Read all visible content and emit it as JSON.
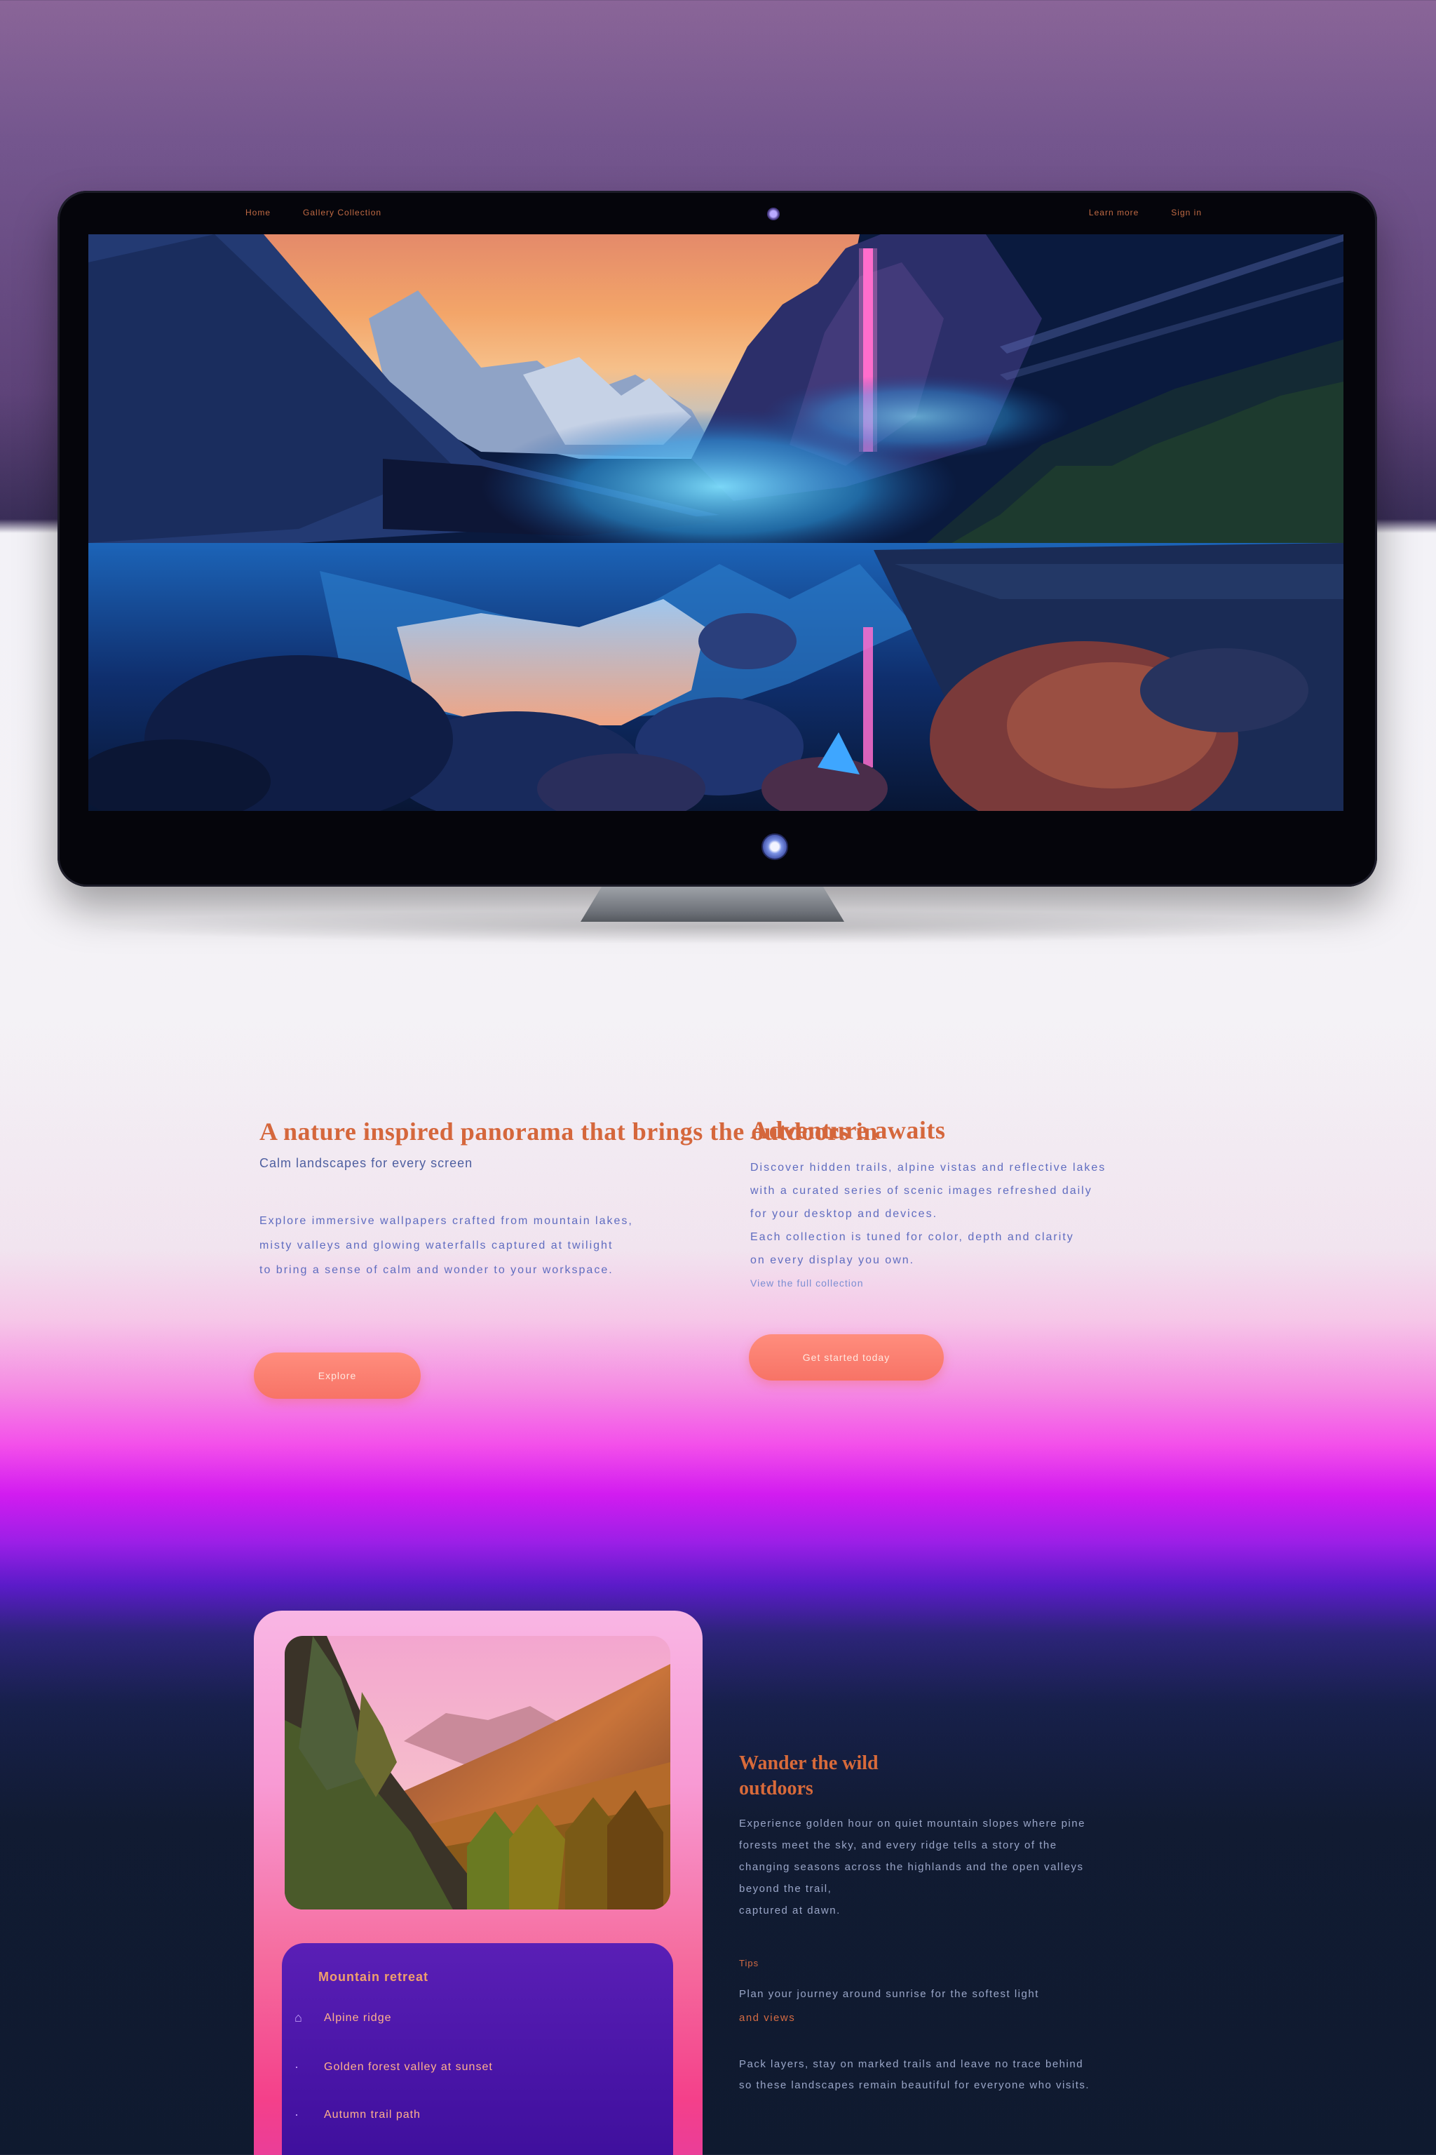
{
  "monitor": {
    "nav_left": [
      "Home",
      "Gallery Collection"
    ],
    "nav_right": [
      "Learn more",
      "Sign in"
    ]
  },
  "feature_left": {
    "title": "A nature inspired panorama that brings the outdoors in",
    "subtitle": "Calm landscapes for every screen",
    "paragraph": [
      "Explore immersive wallpapers crafted from mountain lakes,",
      "misty valleys and glowing waterfalls captured at twilight",
      "to bring a sense of calm and wonder to your workspace."
    ],
    "button_label": "Explore"
  },
  "feature_right": {
    "title": "Adventure awaits",
    "paragraph": [
      "Discover hidden trails, alpine vistas and reflective lakes",
      "with a curated series of scenic images refreshed daily",
      "for your desktop and devices.",
      "Each collection is tuned for color, depth and clarity",
      "on every display you own."
    ],
    "more_link": "View the full collection",
    "button_label": "Get started today"
  },
  "card": {
    "panel_title": "Mountain retreat",
    "items": [
      {
        "icon": "pin-icon",
        "label": "Alpine ridge"
      },
      {
        "icon": "dot-icon",
        "label": "Golden forest valley at sunset"
      },
      {
        "icon": "dot-icon",
        "label": "Autumn trail path"
      }
    ]
  },
  "dark_section": {
    "title_line1": "Wander the wild",
    "title_line2": "outdoors",
    "body": [
      "Experience golden hour on quiet mountain slopes where pine",
      "forests meet the sky, and every ridge tells a story of the",
      "changing seasons across the highlands and the open valleys",
      "beyond the trail,",
      "captured at dawn."
    ],
    "label": "Tips",
    "body2": [
      "Plan your journey around sunrise for the softest light",
      "and views"
    ],
    "body3": [
      "Pack layers, stay on marked trails and leave no trace behind",
      "so these landscapes remain beautiful for everyone who visits."
    ]
  },
  "colors": {
    "accent": "#d5673c",
    "button": "#f77366",
    "card_panel": "#4613a4"
  }
}
